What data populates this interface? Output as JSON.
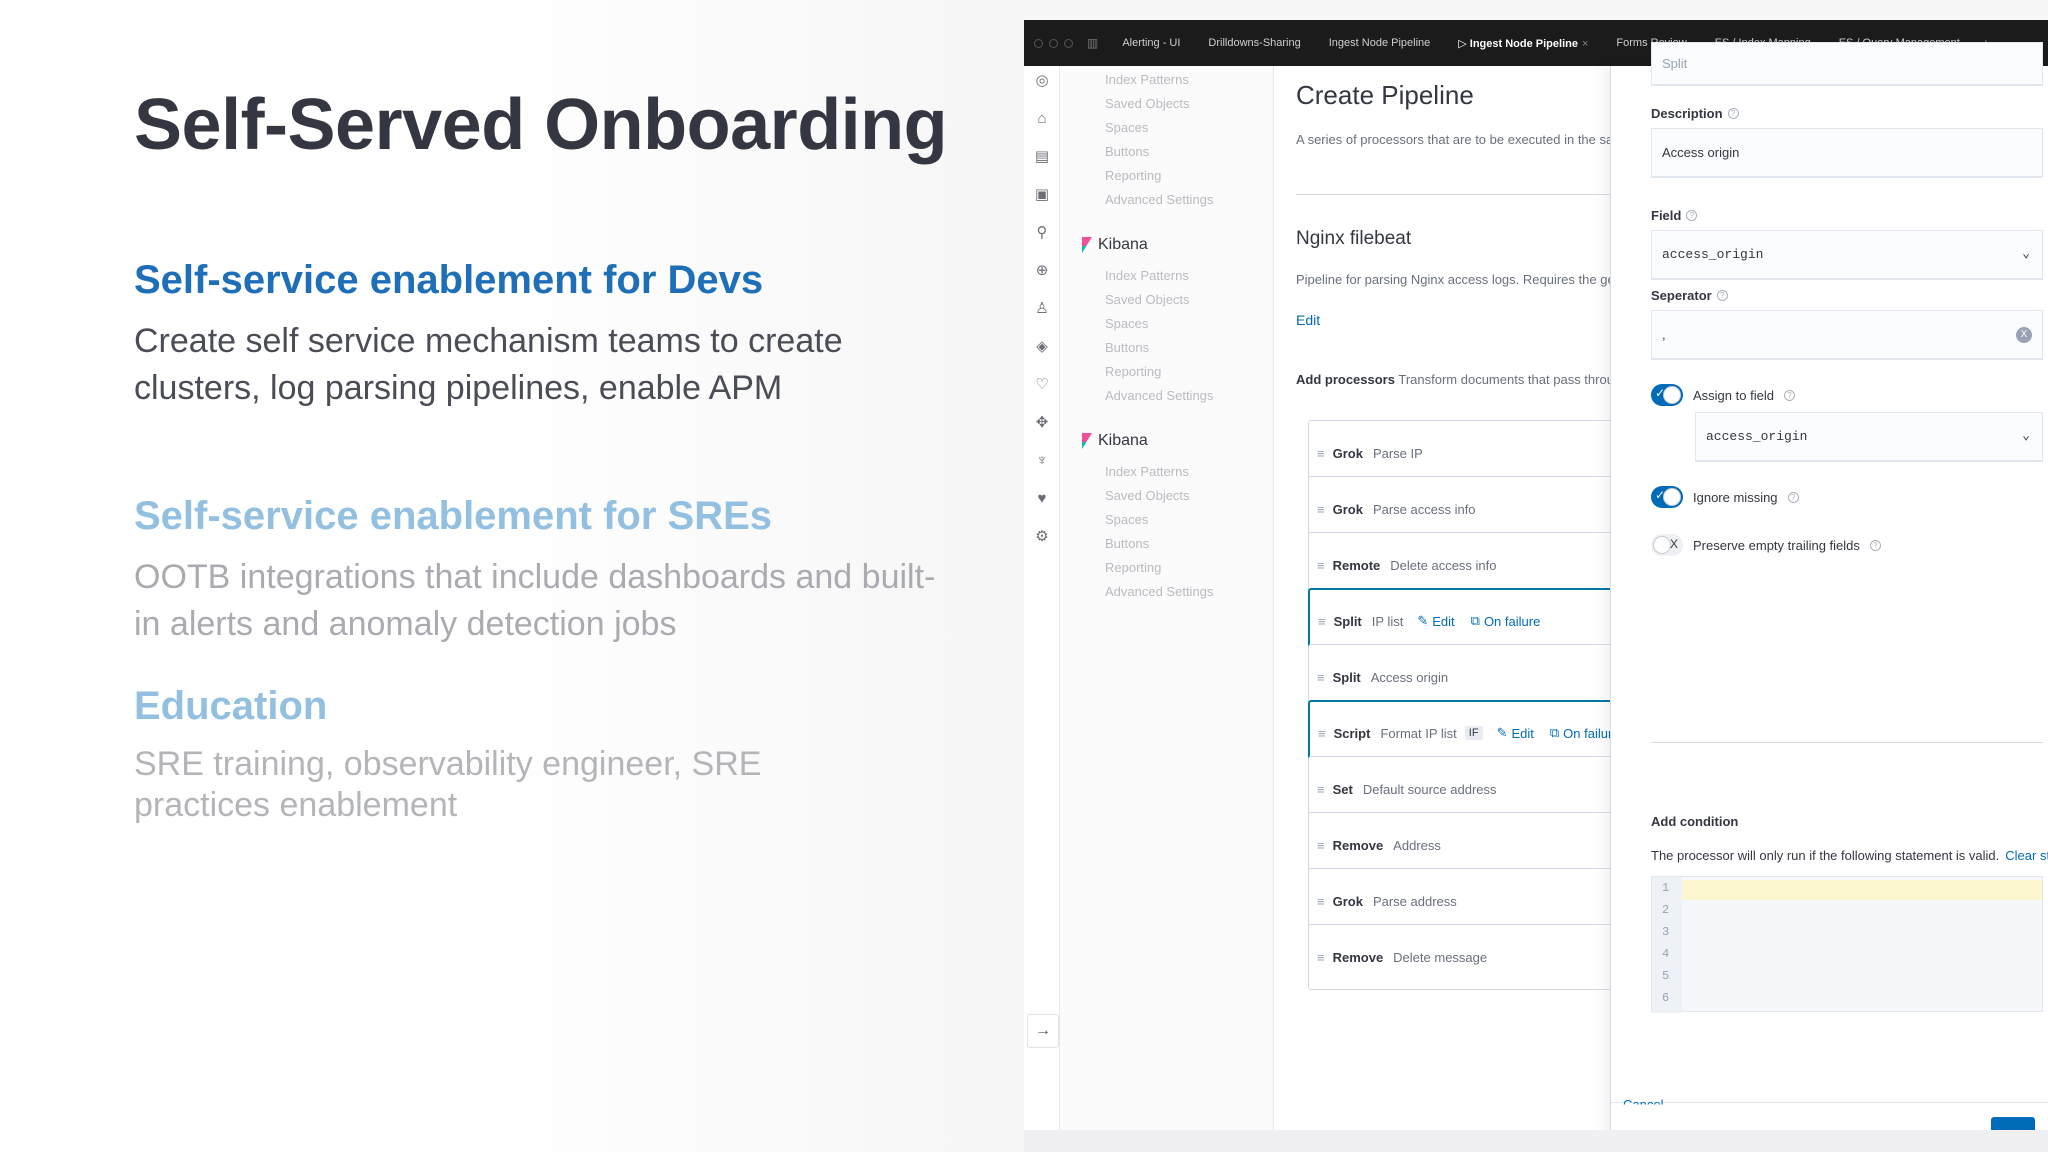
{
  "slide": {
    "title": "Self-Served Onboarding",
    "sections": [
      {
        "heading": "Self-service enablement for Devs",
        "body": "Create self service mechanism teams to create clusters, log parsing pipelines, enable APM"
      },
      {
        "heading": "Self-service enablement for SREs",
        "body": "OOTB integrations that include dashboards and built-in alerts and anomaly detection jobs"
      },
      {
        "heading": "Education",
        "body": "SRE training, observability engineer, SRE practices enablement"
      }
    ]
  },
  "browser": {
    "tabs": [
      "Alerting - UI",
      "Drilldowns-Sharing",
      "Ingest Node Pipeline",
      "Ingest Node Pipeline",
      "Forms Review",
      "ES / Index Mapping",
      "ES / Query Management"
    ],
    "active_tab": 3,
    "close_glyph": "×",
    "plus_glyph": "+"
  },
  "nav": {
    "top_items": [
      "Index Patterns",
      "Saved Objects",
      "Spaces",
      "Buttons",
      "Reporting",
      "Advanced Settings"
    ],
    "groups": [
      {
        "name": "Kibana",
        "items": [
          "Index Patterns",
          "Saved Objects",
          "Spaces",
          "Buttons",
          "Reporting",
          "Advanced Settings"
        ]
      },
      {
        "name": "Kibana",
        "items": [
          "Index Patterns",
          "Saved Objects",
          "Spaces",
          "Buttons",
          "Reporting",
          "Advanced Settings"
        ]
      }
    ],
    "rail_icons": [
      "compass-icon",
      "home-icon",
      "dashboard-icon",
      "calendar-icon",
      "map-icon",
      "globe-icon",
      "user-icon",
      "shield-icon",
      "heart-icon",
      "apm-icon",
      "bulb-icon",
      "heartbeat-icon",
      "gear-icon"
    ],
    "expand_glyph": "→"
  },
  "pipeline": {
    "title": "Create Pipeline",
    "description": "A series of processors that are to be executed in the same order as t",
    "name": "Nginx filebeat",
    "name_description": "Pipeline for parsing Nginx access logs. Requires the geoip ar",
    "edit_label": "Edit",
    "add_processors_label": "Add processors",
    "add_processors_desc": "Transform documents that pass through the pipelin",
    "processors": [
      {
        "type": "Grok",
        "desc": "Parse IP"
      },
      {
        "type": "Grok",
        "desc": "Parse access info"
      },
      {
        "type": "Remote",
        "desc": "Delete access info"
      },
      {
        "type": "Split",
        "desc": "IP list",
        "edit": "Edit",
        "failure": "On failure"
      },
      {
        "type": "Split",
        "desc": "Access origin"
      },
      {
        "type": "Script",
        "desc": "Format IP list",
        "badge": "IF",
        "edit": "Edit",
        "failure": "On failure"
      },
      {
        "type": "Set",
        "desc": "Default source address"
      },
      {
        "type": "Remove",
        "desc": "Address"
      },
      {
        "type": "Grok",
        "desc": "Parse address"
      },
      {
        "type": "Remove",
        "desc": "Delete message"
      }
    ]
  },
  "flyout": {
    "top_value": "Split",
    "description_label": "Description",
    "description_value": "Access origin",
    "field_label": "Field",
    "field_value": "access_origin",
    "separator_label": "Seperator",
    "separator_value": ",",
    "assign_label": "Assign to field",
    "assign_value": "access_origin",
    "ignore_label": "Ignore missing",
    "preserve_label": "Preserve empty trailing fields",
    "condition_title": "Add condition",
    "condition_desc": "The processor will only run if the following statement is valid.",
    "clear_label": "Clear statement",
    "line_numbers": [
      "1",
      "2",
      "3",
      "4",
      "5",
      "6"
    ],
    "cancel_label": "Cancel",
    "help_glyph": "?",
    "check_glyph": "✓",
    "x_glyph": "X",
    "chevron_glyph": "⌄"
  }
}
